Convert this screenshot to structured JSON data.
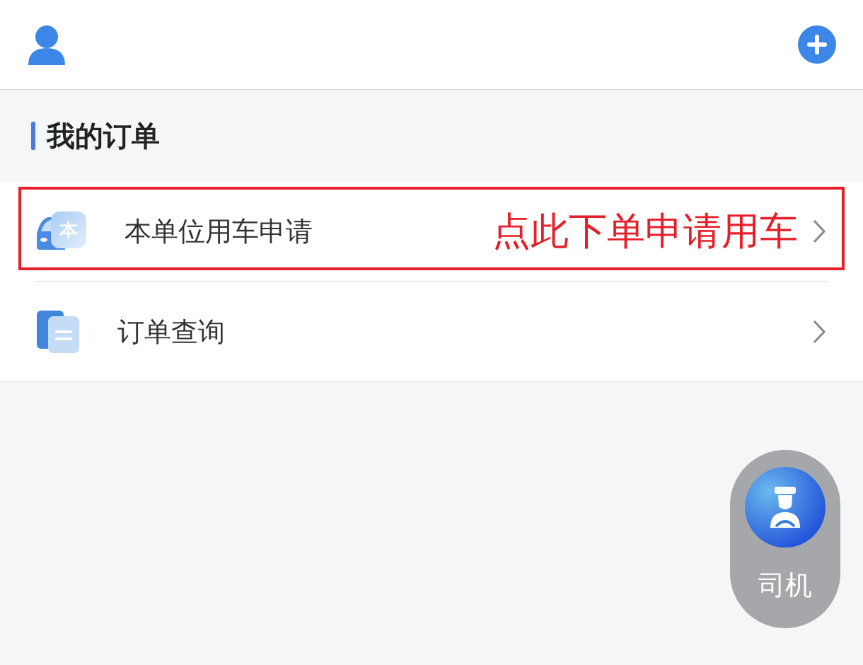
{
  "section": {
    "title": "我的订单"
  },
  "items": [
    {
      "kind": "car",
      "label": "本单位用车申请",
      "icon_text": "本",
      "annotation": "点此下单申请用车",
      "highlighted": true
    },
    {
      "kind": "docs",
      "label": "订单查询",
      "highlighted": false
    }
  ],
  "fab": {
    "label": "司机"
  }
}
